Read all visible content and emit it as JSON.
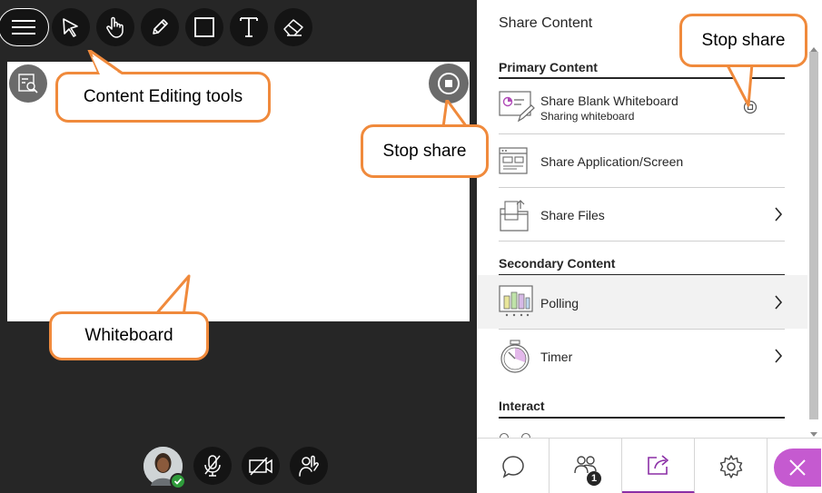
{
  "panel": {
    "title": "Share Content",
    "primary_section": "Primary Content",
    "secondary_section": "Secondary Content",
    "interact_section": "Interact",
    "items": [
      {
        "label": "Share Blank Whiteboard",
        "sub": "Sharing whiteboard"
      },
      {
        "label": "Share Application/Screen"
      },
      {
        "label": "Share Files"
      },
      {
        "label": "Polling"
      },
      {
        "label": "Timer"
      }
    ]
  },
  "tabs": {
    "participants_badge": "1"
  },
  "callouts": {
    "editing_tools": "Content Editing tools",
    "stop_share_left": "Stop share",
    "stop_share_right": "Stop share",
    "whiteboard": "Whiteboard"
  },
  "colors": {
    "accent": "#8b2fa6",
    "close": "#c55ad0",
    "callout_border": "#f08a3c",
    "stage": "#262626"
  }
}
